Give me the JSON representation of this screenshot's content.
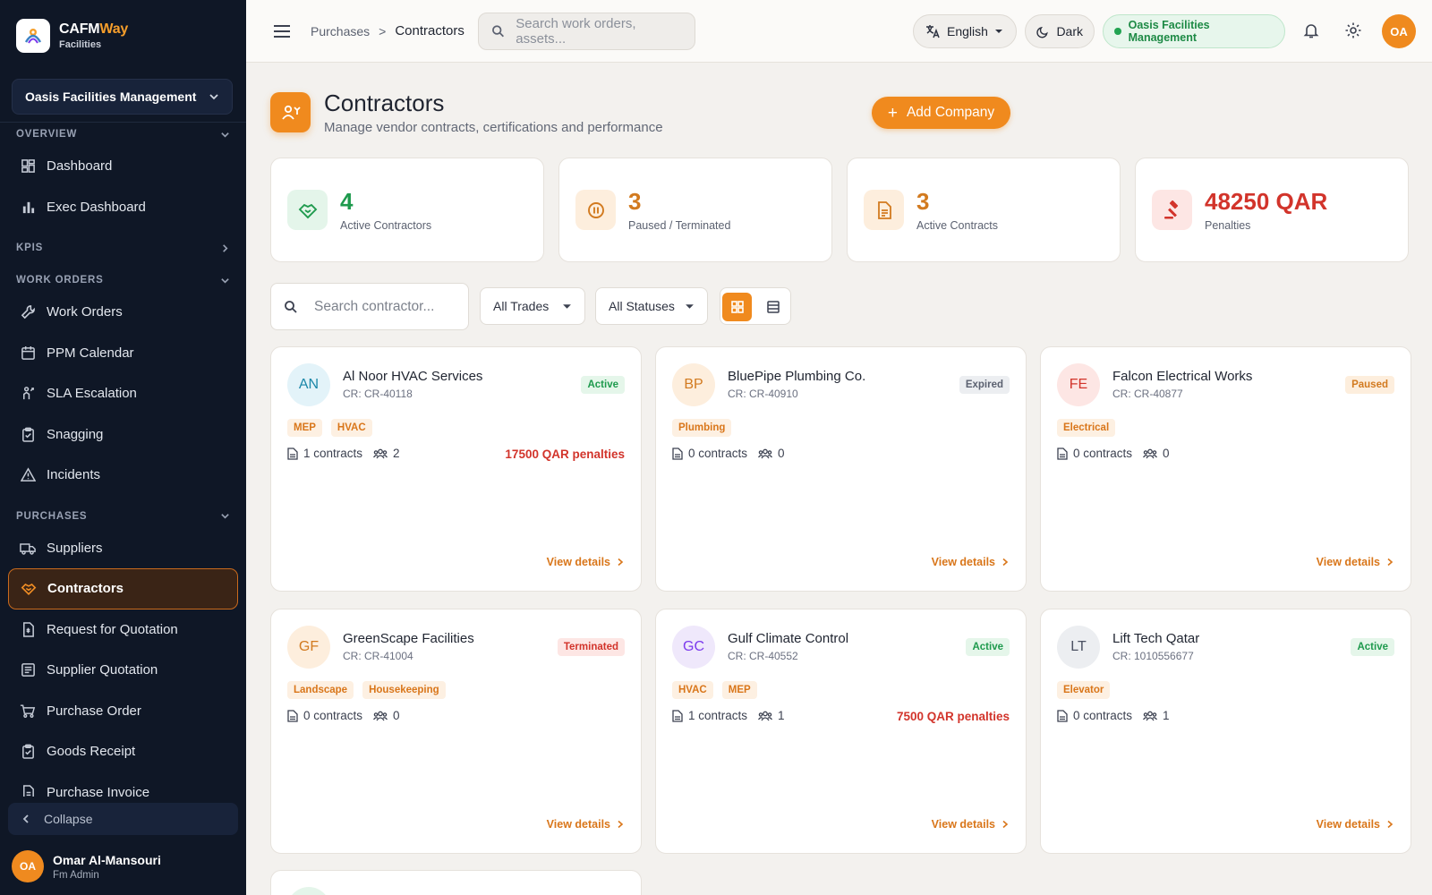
{
  "app": {
    "name_main": "CAFM",
    "name_accent": "Way",
    "subtitle": "Facilities",
    "org": "Oasis Facilities Management"
  },
  "sidebar": {
    "sections": {
      "overview": "OVERVIEW",
      "kpis": "KPIS",
      "work_orders": "WORK ORDERS",
      "purchases": "PURCHASES"
    },
    "items": {
      "dashboard": "Dashboard",
      "exec_dashboard": "Exec Dashboard",
      "work_orders": "Work Orders",
      "ppm_calendar": "PPM Calendar",
      "sla_escalation": "SLA Escalation",
      "snagging": "Snagging",
      "incidents": "Incidents",
      "suppliers": "Suppliers",
      "contractors": "Contractors",
      "rfq": "Request for Quotation",
      "supplier_quotation": "Supplier Quotation",
      "purchase_order": "Purchase Order",
      "goods_receipt": "Goods Receipt",
      "purchase_invoice": "Purchase Invoice"
    },
    "collapse": "Collapse",
    "user": {
      "initials": "OA",
      "name": "Omar Al-Mansouri",
      "role": "Fm Admin"
    }
  },
  "topbar": {
    "breadcrumb_parent": "Purchases",
    "breadcrumb_sep": ">",
    "breadcrumb_current": "Contractors",
    "search_placeholder": "Search work orders, assets...",
    "language": "English",
    "theme": "Dark",
    "org_badge": "Oasis Facilities Management",
    "avatar": "OA"
  },
  "page": {
    "title": "Contractors",
    "subtitle": "Manage vendor contracts, certifications and performance",
    "add_button": "Add Company"
  },
  "stats": [
    {
      "value": "4",
      "label": "Active Contractors",
      "color": "#1e9a4d",
      "bg": "#e4f5ea",
      "icon": "handshake-icon"
    },
    {
      "value": "3",
      "label": "Paused / Terminated",
      "color": "#d27a1f",
      "bg": "#fdeedd",
      "icon": "pause-icon"
    },
    {
      "value": "3",
      "label": "Active Contracts",
      "color": "#d27a1f",
      "bg": "#fdeedd",
      "icon": "document-icon"
    },
    {
      "value": "48250 QAR",
      "label": "Penalties",
      "color": "#d2342b",
      "bg": "#fde6e4",
      "icon": "gavel-icon"
    }
  ],
  "filters": {
    "search_placeholder": "Search contractor...",
    "trades": "All Trades",
    "statuses": "All Statuses"
  },
  "cards": [
    {
      "initials": "AN",
      "name": "Al Noor HVAC Services",
      "cr": "CR: CR-40118",
      "status": "Active",
      "tags": [
        "MEP",
        "HVAC"
      ],
      "contracts": "1 contracts",
      "people": "2",
      "penalty": "17500 QAR penalties",
      "link": "View details"
    },
    {
      "initials": "BP",
      "name": "BluePipe Plumbing Co.",
      "cr": "CR: CR-40910",
      "status": "Expired",
      "tags": [
        "Plumbing"
      ],
      "contracts": "0 contracts",
      "people": "0",
      "penalty": "",
      "link": "View details"
    },
    {
      "initials": "FE",
      "name": "Falcon Electrical Works",
      "cr": "CR: CR-40877",
      "status": "Paused",
      "tags": [
        "Electrical"
      ],
      "contracts": "0 contracts",
      "people": "0",
      "penalty": "",
      "link": "View details"
    },
    {
      "initials": "GF",
      "name": "GreenScape Facilities",
      "cr": "CR: CR-41004",
      "status": "Terminated",
      "tags": [
        "Landscape",
        "Housekeeping"
      ],
      "contracts": "0 contracts",
      "people": "0",
      "penalty": "",
      "link": "View details"
    },
    {
      "initials": "GC",
      "name": "Gulf Climate Control",
      "cr": "CR: CR-40552",
      "status": "Active",
      "tags": [
        "HVAC",
        "MEP"
      ],
      "contracts": "1 contracts",
      "people": "1",
      "penalty": "7500 QAR penalties",
      "link": "View details"
    },
    {
      "initials": "LT",
      "name": "Lift Tech Qatar",
      "cr": "CR: 1010556677",
      "status": "Active",
      "tags": [
        "Elevator"
      ],
      "contracts": "0 contracts",
      "people": "1",
      "penalty": "",
      "link": "View details"
    }
  ]
}
